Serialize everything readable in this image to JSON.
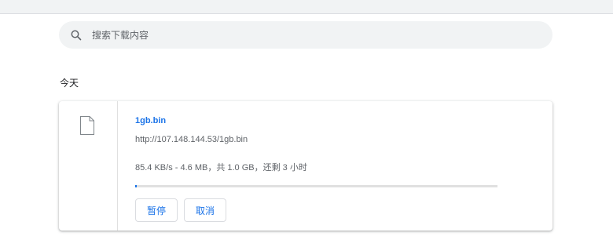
{
  "search": {
    "placeholder": "搜索下载内容",
    "icon": "search-icon"
  },
  "downloads": {
    "date_header": "今天",
    "items": [
      {
        "file_name": "1gb.bin",
        "url": "http://107.148.144.53/1gb.bin",
        "status": "85.4 KB/s - 4.6 MB，共 1.0 GB，还剩 3 小时",
        "progress": 0.0045,
        "icon": "file-icon",
        "pause_label": "暂停",
        "cancel_label": "取消"
      }
    ]
  },
  "colors": {
    "accent": "#1a73e8",
    "toolbar_bg": "#f1f3f4",
    "progress_track": "#e0e0e0"
  }
}
